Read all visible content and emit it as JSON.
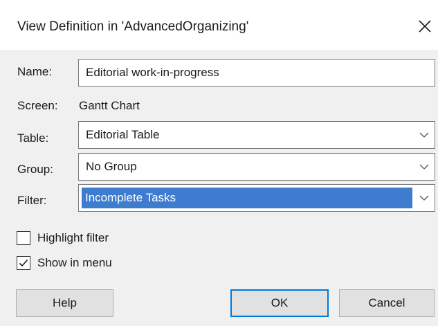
{
  "window": {
    "title": "View Definition in 'AdvancedOrganizing'",
    "close_icon": "close-icon"
  },
  "form": {
    "name_label": "Name:",
    "name_value": "Editorial work-in-progress",
    "screen_label": "Screen:",
    "screen_value": "Gantt Chart",
    "table_label": "Table:",
    "table_value": "Editorial Table",
    "group_label": "Group:",
    "group_value": "No Group",
    "filter_label": "Filter:",
    "filter_value": "Incomplete Tasks"
  },
  "options": {
    "highlight_filter_label": "Highlight filter",
    "highlight_filter_checked": false,
    "show_in_menu_label": "Show in menu",
    "show_in_menu_checked": true
  },
  "buttons": {
    "help": "Help",
    "ok": "OK",
    "cancel": "Cancel"
  },
  "colors": {
    "selection": "#3d7ccf",
    "default_button_border": "#0078d7"
  }
}
